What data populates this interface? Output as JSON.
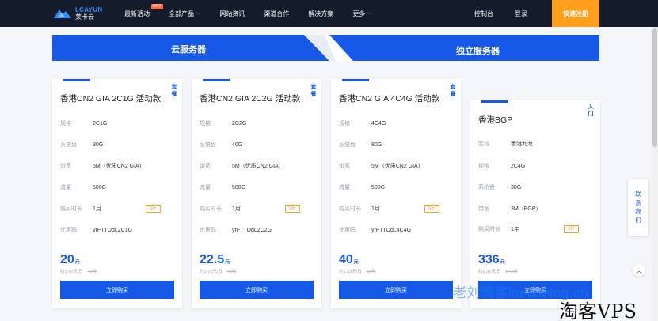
{
  "brand": {
    "name_en": "LCAYUN",
    "name_cn": "莱卡云"
  },
  "nav": {
    "items": [
      {
        "label": "最新活动",
        "badge": "HOT"
      },
      {
        "label": "全部产品",
        "dropdown": true
      },
      {
        "label": "网站资讯"
      },
      {
        "label": "渠道合作"
      },
      {
        "label": "解决方案"
      },
      {
        "label": "更多",
        "dropdown": true
      }
    ],
    "console": "控制台",
    "login": "登录",
    "signup": "快速注册"
  },
  "tabs": {
    "cloud": "云服务器",
    "dedicated": "独立服务器"
  },
  "cards": [
    {
      "title": "香港CN2 GIA 2C1G 活动款",
      "side": "套餐",
      "rows": [
        {
          "k": "规格",
          "v": "2C1G"
        },
        {
          "k": "系统盘",
          "v": "30G"
        },
        {
          "k": "带宽",
          "v": "5M（优质CN2 GIA）"
        },
        {
          "k": "流量",
          "v": "500G"
        },
        {
          "k": "购买时长",
          "v": "1月",
          "tag": "9折"
        },
        {
          "k": "优惠码",
          "v": "yrFTTOdL2C1G"
        }
      ],
      "price": "20",
      "unit": "元",
      "sub": "约0.66元/日",
      "orig": "40元",
      "buy": "立即购买"
    },
    {
      "title": "香港CN2 GIA 2C2G 活动款",
      "side": "套餐",
      "rows": [
        {
          "k": "规格",
          "v": "2C2G"
        },
        {
          "k": "系统盘",
          "v": "40G"
        },
        {
          "k": "带宽",
          "v": "5M（优质CN2 GIA）"
        },
        {
          "k": "流量",
          "v": "500G"
        },
        {
          "k": "购买时长",
          "v": "1月",
          "tag": "9折"
        },
        {
          "k": "优惠码",
          "v": "yrFTTOdL2C2G"
        }
      ],
      "price": "22.5",
      "unit": "元",
      "sub": "约0.75元/日",
      "orig": "45元",
      "buy": "立即购买"
    },
    {
      "title": "香港CN2 GIA 4C4G 活动款",
      "side": "套餐",
      "rows": [
        {
          "k": "规格",
          "v": "4C4G"
        },
        {
          "k": "系统盘",
          "v": "80G"
        },
        {
          "k": "带宽",
          "v": "5M（优质CN2 GIA）"
        },
        {
          "k": "流量",
          "v": "500G"
        },
        {
          "k": "购买时长",
          "v": "1月",
          "tag": "9折"
        },
        {
          "k": "优惠码",
          "v": "yrFTTOdL4C4G"
        }
      ],
      "price": "40",
      "unit": "元",
      "sub": "约1.33元/日",
      "orig": "80元",
      "buy": "立即购买"
    },
    {
      "title": "香港BGP",
      "side": "入门",
      "rows": [
        {
          "k": "区域",
          "v": "香港九龙"
        },
        {
          "k": "规格",
          "v": "2C4G"
        },
        {
          "k": "系统盘",
          "v": "30G"
        },
        {
          "k": "带宽",
          "v": "3M（BGP）"
        },
        {
          "k": "购买时长",
          "v": "1年",
          "tag": "5折"
        }
      ],
      "price": "336",
      "unit": "元",
      "sub": "约0.92元/日",
      "orig": "672元",
      "buy": "立即购买"
    }
  ],
  "float_panel": "联系我们",
  "watermarks": {
    "blog": "老刘博客laoliublog.cn",
    "vps": "淘客VPS"
  },
  "colors": {
    "primary": "#1659e6",
    "nav_bg": "#141c2b",
    "signup": "#ff9f1c",
    "tag": "#ff9f1c"
  }
}
